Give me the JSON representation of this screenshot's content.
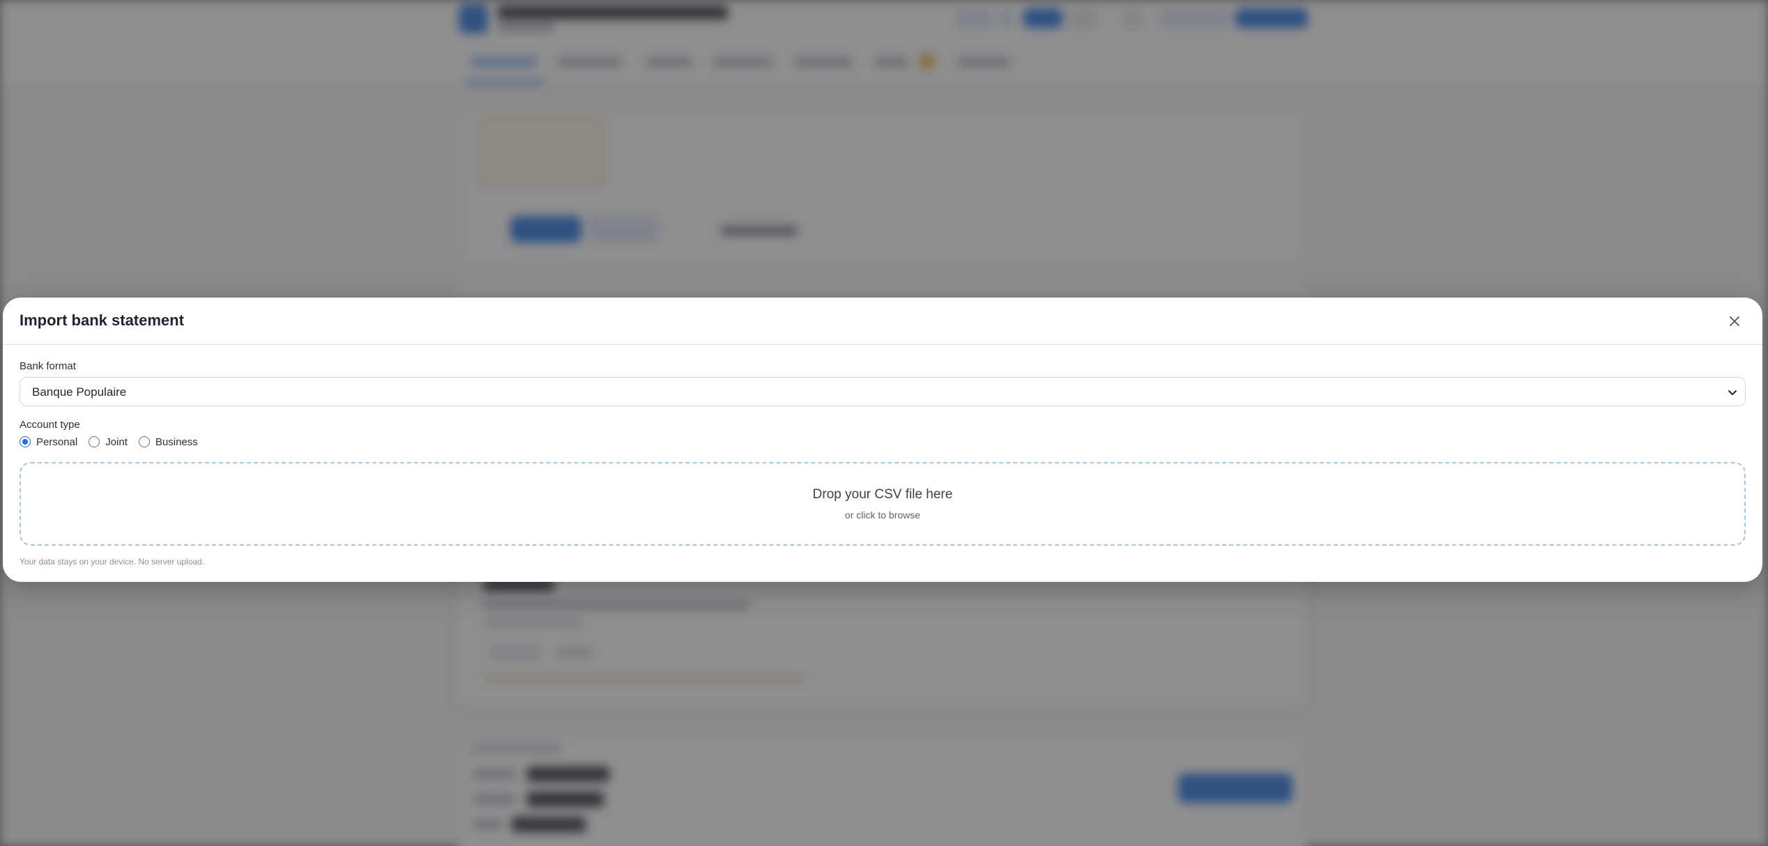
{
  "modal": {
    "title": "Import bank statement",
    "close_icon": "close-icon",
    "bank_format": {
      "label": "Bank format",
      "selected": "Banque Populaire"
    },
    "account_type": {
      "label": "Account type",
      "options": [
        {
          "label": "Personal",
          "checked": true
        },
        {
          "label": "Joint",
          "checked": false
        },
        {
          "label": "Business",
          "checked": false
        }
      ]
    },
    "dropzone": {
      "title": "Drop your CSV file here",
      "subtitle": "or click to browse"
    },
    "privacy_note": "Your data stays on your device. No server upload."
  },
  "colors": {
    "accent": "#1f6fe0",
    "overlay": "#3c3c3e",
    "dropzone_border": "#a9c6dc",
    "warning": "#f0b24a"
  }
}
